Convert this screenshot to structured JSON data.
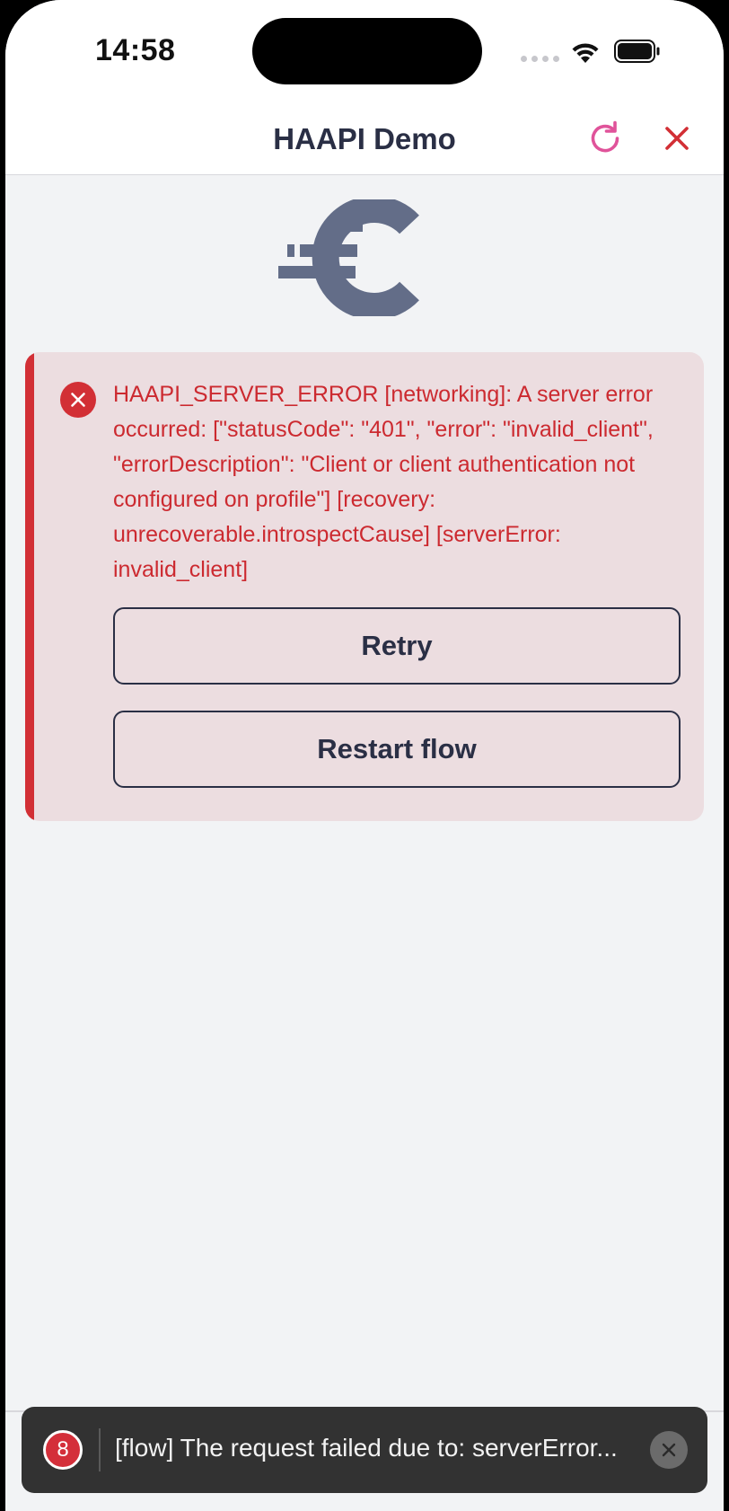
{
  "status_bar": {
    "time": "14:58"
  },
  "nav": {
    "title": "HAAPI Demo",
    "refresh_icon": "refresh-icon",
    "close_icon": "close-icon",
    "accent_refresh": "#e0539a",
    "accent_close": "#d22f35"
  },
  "logo": {
    "icon": "curity-logo"
  },
  "error": {
    "icon": "error-circle-icon",
    "message": "HAAPI_SERVER_ERROR [networking]: A server error occurred: [\"statusCode\": \"401\", \"error\": \"invalid_client\", \"errorDescription\": \"Client or client authentication not configured on profile\"] [recovery: unrecoverable.introspectCause] [serverError: invalid_client]",
    "color": "#d22f35",
    "retry_label": "Retry",
    "restart_label": "Restart flow"
  },
  "toast": {
    "badge_count": "8",
    "text": "[flow] The request failed due to: serverError...",
    "dismiss_icon": "dismiss-icon"
  }
}
